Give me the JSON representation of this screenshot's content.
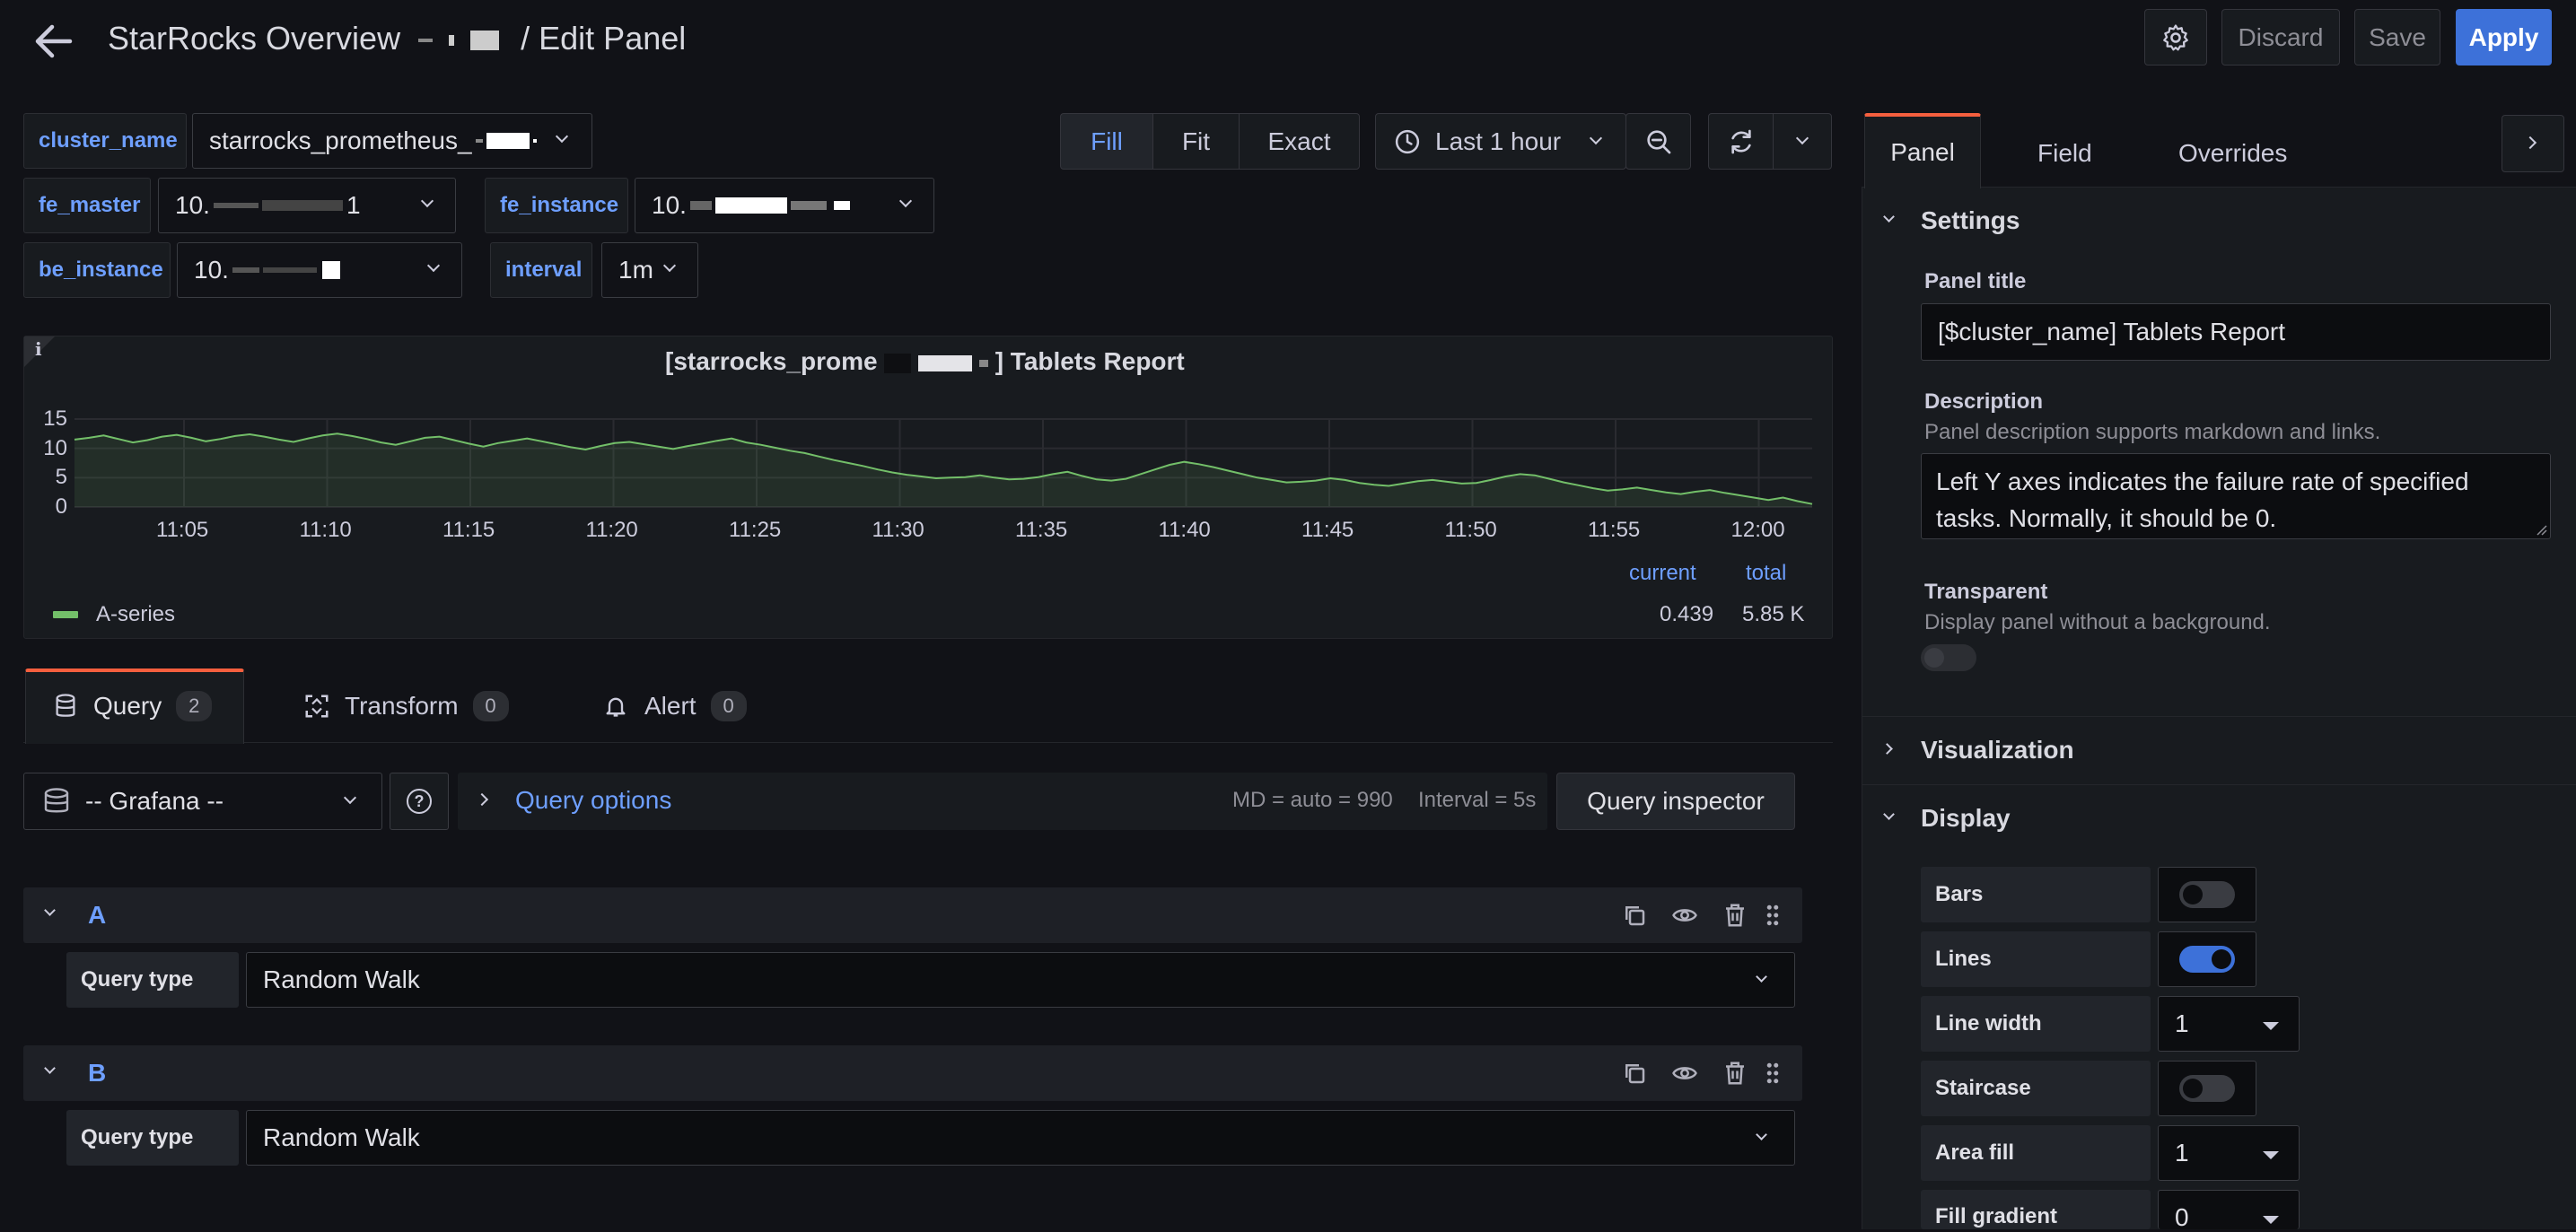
{
  "header": {
    "title_prefix": "StarRocks Overview",
    "title_suffix": "/ Edit Panel",
    "discard_label": "Discard",
    "save_label": "Save",
    "apply_label": "Apply"
  },
  "variables": {
    "cluster_name": {
      "label": "cluster_name",
      "value": "starrocks_prometheus_"
    },
    "fe_master": {
      "label": "fe_master",
      "value": "10.",
      "value_tail": "1"
    },
    "fe_instance": {
      "label": "fe_instance",
      "value": "10."
    },
    "be_instance": {
      "label": "be_instance",
      "value": "10."
    },
    "interval": {
      "label": "interval",
      "value": "1m"
    }
  },
  "toolbar": {
    "fill_label": "Fill",
    "fit_label": "Fit",
    "exact_label": "Exact",
    "time_range": "Last 1 hour"
  },
  "panel": {
    "title_prefix": "[starrocks_prome",
    "title_suffix": "] Tablets Report",
    "info_glyph": "i",
    "legend": {
      "current_header": "current",
      "total_header": "total",
      "series_name": "A-series",
      "current_value": "0.439",
      "total_value": "5.85 K"
    }
  },
  "chart_data": {
    "type": "line",
    "title": "[starrocks_prome…] Tablets Report",
    "x_ticks": [
      "11:05",
      "11:10",
      "11:15",
      "11:20",
      "11:25",
      "11:30",
      "11:35",
      "11:40",
      "11:45",
      "11:50",
      "11:55",
      "12:00"
    ],
    "y_ticks": [
      "0",
      "5",
      "10",
      "15"
    ],
    "ylim": [
      0,
      15
    ],
    "series": [
      {
        "name": "A-series",
        "color": "#73bf69",
        "fill": true,
        "values": [
          11.5,
          11.8,
          12.2,
          11.6,
          11.0,
          11.4,
          12.0,
          12.3,
          11.8,
          11.2,
          11.6,
          12.1,
          12.4,
          12.0,
          11.5,
          11.1,
          11.7,
          12.2,
          12.5,
          12.1,
          11.6,
          11.0,
          10.6,
          11.2,
          11.8,
          12.0,
          11.4,
          10.8,
          10.3,
          10.9,
          11.3,
          11.7,
          11.2,
          10.7,
          10.2,
          9.8,
          10.4,
          10.9,
          11.1,
          10.7,
          10.3,
          9.9,
          10.4,
          10.8,
          11.3,
          11.7,
          11.0,
          10.6,
          10.1,
          9.6,
          9.2,
          8.6,
          8.0,
          7.5,
          7.0,
          6.4,
          5.9,
          5.5,
          5.2,
          4.9,
          5.0,
          5.1,
          5.4,
          5.0,
          4.7,
          4.8,
          5.1,
          5.6,
          6.0,
          5.3,
          4.7,
          4.5,
          4.8,
          5.6,
          6.4,
          7.2,
          7.7,
          7.3,
          6.8,
          6.2,
          5.6,
          5.0,
          4.6,
          4.2,
          4.3,
          4.5,
          4.9,
          4.6,
          4.1,
          3.8,
          3.6,
          4.0,
          4.4,
          4.6,
          4.3,
          4.0,
          4.1,
          4.6,
          5.2,
          5.6,
          5.4,
          4.8,
          4.2,
          3.7,
          3.2,
          2.8,
          3.0,
          3.3,
          2.9,
          2.5,
          2.2,
          2.6,
          2.9,
          2.4,
          2.0,
          1.6,
          1.2,
          1.6,
          1.0,
          0.5
        ]
      }
    ]
  },
  "query_tabs": [
    {
      "label": "Query",
      "count": "2"
    },
    {
      "label": "Transform",
      "count": "0"
    },
    {
      "label": "Alert",
      "count": "0"
    }
  ],
  "query_bar": {
    "datasource": "-- Grafana --",
    "help_glyph": "?",
    "query_options_label": "Query options",
    "md_info": "MD = auto = 990",
    "interval_info": "Interval = 5s",
    "inspector_label": "Query inspector"
  },
  "queries": [
    {
      "ref": "A",
      "type_label": "Query type",
      "type_value": "Random Walk"
    },
    {
      "ref": "B",
      "type_label": "Query type",
      "type_value": "Random Walk"
    }
  ],
  "sidebar": {
    "tabs": [
      "Panel",
      "Field",
      "Overrides"
    ],
    "settings_label": "Settings",
    "panel_title_label": "Panel title",
    "panel_title_value": "[$cluster_name] Tablets Report",
    "description_label": "Description",
    "description_help": "Panel description supports markdown and links.",
    "description_line1": "Left Y axes indicates the failure rate of specified",
    "description_line2": "tasks. Normally, it should be 0.",
    "transparent_label": "Transparent",
    "transparent_help": "Display panel without a background.",
    "visualization_label": "Visualization",
    "display_label": "Display",
    "display_items": {
      "bars": {
        "label": "Bars",
        "on": false
      },
      "lines": {
        "label": "Lines",
        "on": true
      },
      "line_width": {
        "label": "Line width",
        "value": "1"
      },
      "staircase": {
        "label": "Staircase",
        "on": false
      },
      "area_fill": {
        "label": "Area fill",
        "value": "1"
      },
      "fill_gradient": {
        "label": "Fill gradient",
        "value": "0"
      }
    }
  },
  "colors": {
    "accent_blue": "#3d71d9",
    "link_blue": "#6e9fff",
    "series_green": "#73bf69",
    "active_tab_gradient": "#f55f3e"
  }
}
